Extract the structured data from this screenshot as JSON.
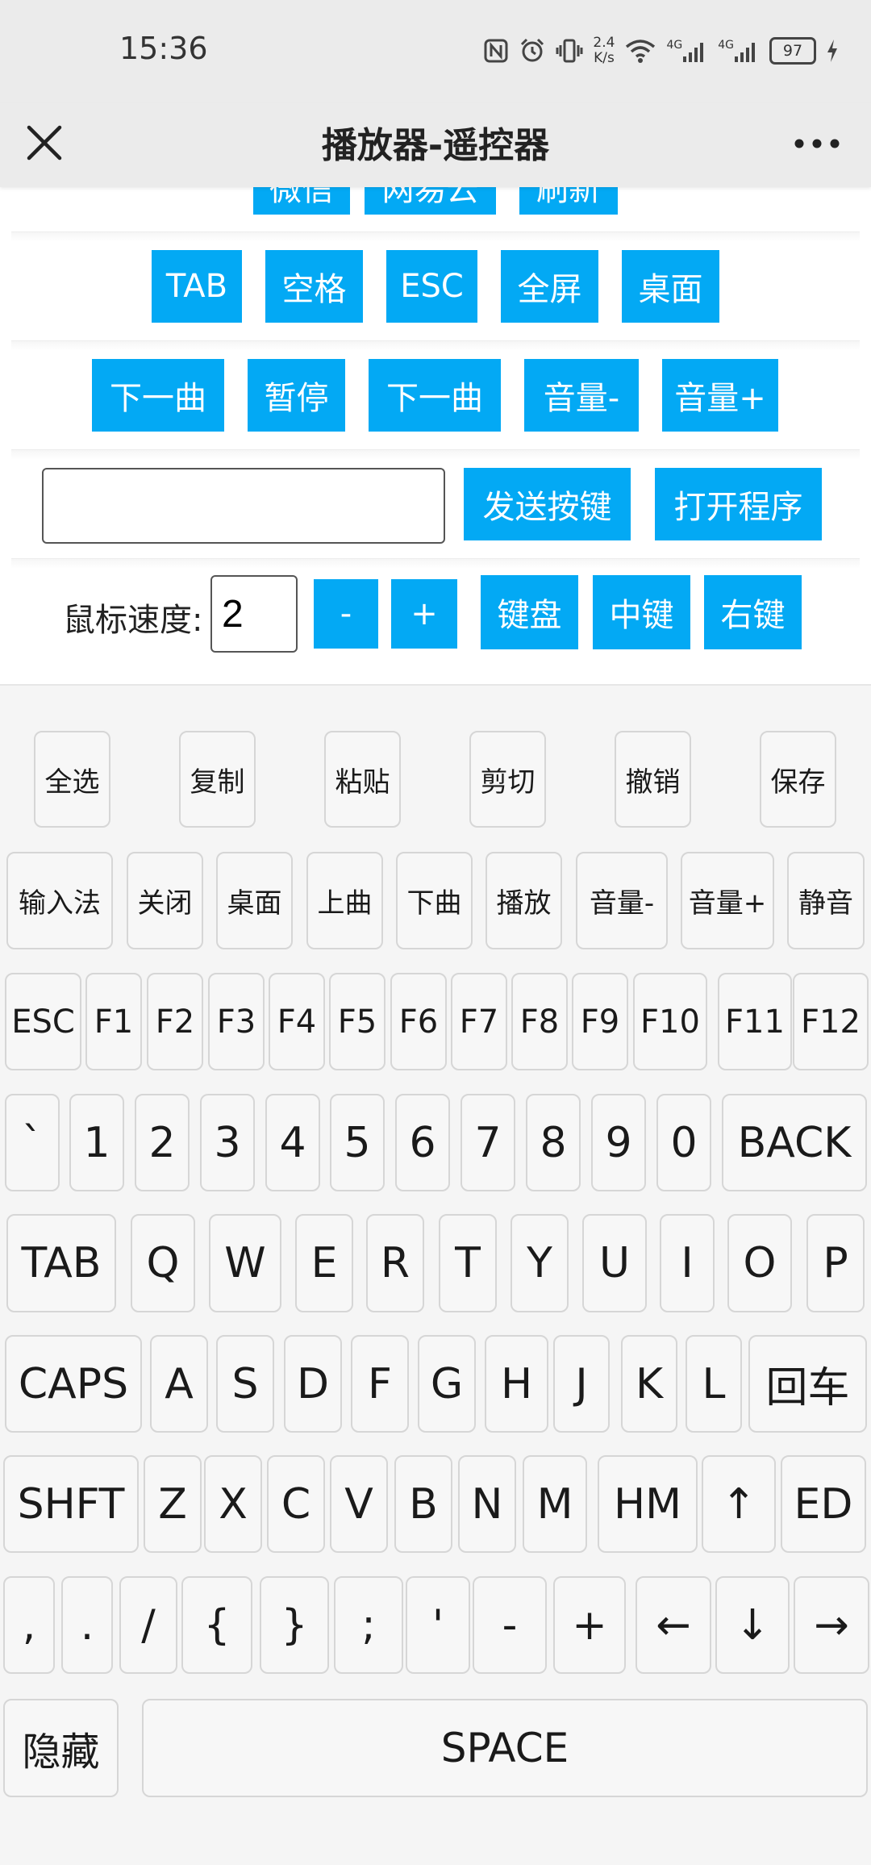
{
  "status_bar": {
    "time": "15:36",
    "net_speed_value": "2.4",
    "net_speed_unit": "K/s",
    "signal_1": "4G",
    "signal_2": "4G",
    "battery": "97",
    "icons": [
      "nfc-icon",
      "alarm-icon",
      "vibrate-icon",
      "wifi-icon",
      "signal-icon",
      "battery-icon",
      "charging-icon"
    ]
  },
  "header": {
    "title": "播放器-遥控器",
    "close_icon": "close-icon",
    "more_icon": "more-icon"
  },
  "controls": {
    "row_partial": [
      "微信",
      "网易云",
      "刷新"
    ],
    "row_keys": [
      "TAB",
      "空格",
      "ESC",
      "全屏",
      "桌面"
    ],
    "row_media": [
      "下一曲",
      "暂停",
      "下一曲",
      "音量-",
      "音量+"
    ],
    "key_input": {
      "value": "",
      "placeholder": ""
    },
    "send_key": "发送按键",
    "open_program": "打开程序",
    "mouse_speed_label": "鼠标速度:",
    "mouse_speed_value": "2",
    "mouse_buttons": [
      "-",
      "+",
      "键盘",
      "中键",
      "右键"
    ]
  },
  "keyboard": {
    "shortcuts": [
      "全选",
      "复制",
      "粘贴",
      "剪切",
      "撤销",
      "保存"
    ],
    "functions": [
      "输入法",
      "关闭",
      "桌面",
      "上曲",
      "下曲",
      "播放",
      "音量-",
      "音量+",
      "静音"
    ],
    "fkeys": [
      "ESC",
      "F1",
      "F2",
      "F3",
      "F4",
      "F5",
      "F6",
      "F7",
      "F8",
      "F9",
      "F10",
      "F11",
      "F12"
    ],
    "numbers": [
      "`",
      "1",
      "2",
      "3",
      "4",
      "5",
      "6",
      "7",
      "8",
      "9",
      "0",
      "BACK"
    ],
    "qwerty": [
      "TAB",
      "Q",
      "W",
      "E",
      "R",
      "T",
      "Y",
      "U",
      "I",
      "O",
      "P"
    ],
    "asdf": [
      "CAPS",
      "A",
      "S",
      "D",
      "F",
      "G",
      "H",
      "J",
      "K",
      "L",
      "回车"
    ],
    "zxcv": [
      "SHFT",
      "Z",
      "X",
      "C",
      "V",
      "B",
      "N",
      "M",
      "HM",
      "↑",
      "ED"
    ],
    "symbols": [
      ",",
      ".",
      "/",
      "{",
      "}",
      ";",
      "'",
      "-",
      "+",
      "←",
      "↓",
      "→"
    ],
    "hide": "隐藏",
    "space": "SPACE"
  }
}
